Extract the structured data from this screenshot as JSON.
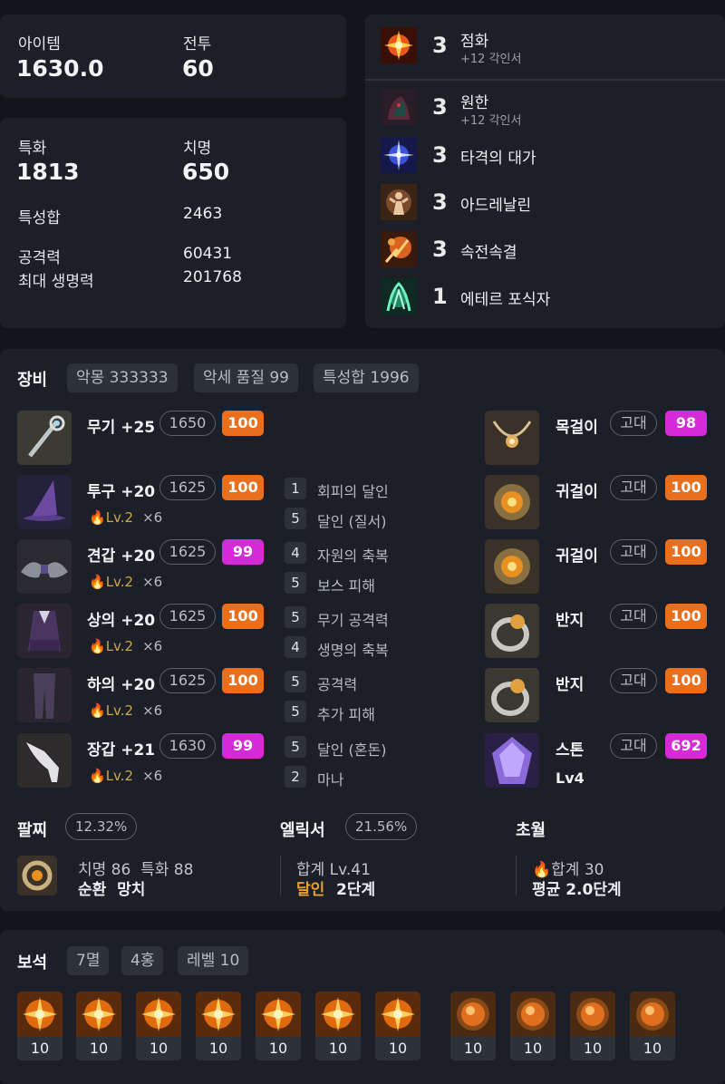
{
  "summary": {
    "item_label": "아이템",
    "item_value": "1630.0",
    "combat_label": "전투",
    "combat_value": "60"
  },
  "stats": {
    "spec_label": "특화",
    "spec_value": "1813",
    "crit_label": "치명",
    "crit_value": "650",
    "sum_label": "특성합",
    "sum_value": "2463",
    "atk_label": "공격력",
    "atk_value": "60431",
    "hp_label": "최대 생명력",
    "hp_value": "201768"
  },
  "engravings": [
    {
      "level": "3",
      "name": "점화",
      "sub": "+12 각인서",
      "icon": "fire-ignite-icon"
    },
    {
      "level": "3",
      "name": "원한",
      "sub": "+12 각인서",
      "icon": "grudge-icon"
    },
    {
      "level": "3",
      "name": "타격의 대가",
      "icon": "hit-master-icon"
    },
    {
      "level": "3",
      "name": "아드레날린",
      "icon": "adrenaline-icon"
    },
    {
      "level": "3",
      "name": "속전속결",
      "icon": "swift-strike-icon"
    },
    {
      "level": "1",
      "name": "에테르 포식자",
      "icon": "ether-predator-icon"
    }
  ],
  "equipment": {
    "title": "장비",
    "tags": [
      "악몽 333333",
      "악세 품질 99",
      "특성합 1996"
    ],
    "items": [
      {
        "name": "무기 +25",
        "ilvl": "1650",
        "quality": "100",
        "quality_color": "#ea6f1d",
        "icon": "weapon-staff-icon"
      },
      {
        "name": "투구 +20",
        "ilvl": "1625",
        "quality": "100",
        "quality_color": "#ea6f1d",
        "ability_stone": "Lv.2",
        "mult": "×6",
        "icon": "helmet-witch-hat-icon"
      },
      {
        "name": "견갑 +20",
        "ilvl": "1625",
        "quality": "99",
        "quality_color": "#d42bd6",
        "ability_stone": "Lv.2",
        "mult": "×6",
        "icon": "shoulder-armor-icon"
      },
      {
        "name": "상의 +20",
        "ilvl": "1625",
        "quality": "100",
        "quality_color": "#ea6f1d",
        "ability_stone": "Lv.2",
        "mult": "×6",
        "icon": "chest-armor-icon"
      },
      {
        "name": "하의 +20",
        "ilvl": "1625",
        "quality": "100",
        "quality_color": "#ea6f1d",
        "ability_stone": "Lv.2",
        "mult": "×6",
        "icon": "pants-armor-icon"
      },
      {
        "name": "장갑 +21",
        "ilvl": "1630",
        "quality": "99",
        "quality_color": "#d42bd6",
        "ability_stone": "Lv.2",
        "mult": "×6",
        "icon": "gloves-armor-icon"
      }
    ],
    "effects": [
      {
        "level": "1",
        "name": "회피의 달인"
      },
      {
        "level": "5",
        "name": "달인 (질서)"
      },
      {
        "level": "4",
        "name": "자원의 축복"
      },
      {
        "level": "5",
        "name": "보스 피해"
      },
      {
        "level": "5",
        "name": "무기 공격력"
      },
      {
        "level": "4",
        "name": "생명의 축복"
      },
      {
        "level": "5",
        "name": "공격력"
      },
      {
        "level": "5",
        "name": "추가 피해"
      },
      {
        "level": "5",
        "name": "달인 (혼돈)"
      },
      {
        "level": "2",
        "name": "마나"
      }
    ],
    "accessories": [
      {
        "name": "목걸이",
        "grade": "고대",
        "quality": "98",
        "quality_color": "#d42bd6",
        "icon": "necklace-icon"
      },
      {
        "name": "귀걸이",
        "grade": "고대",
        "quality": "100",
        "quality_color": "#ea6f1d",
        "icon": "earring-icon"
      },
      {
        "name": "귀걸이",
        "grade": "고대",
        "quality": "100",
        "quality_color": "#ea6f1d",
        "icon": "earring-icon"
      },
      {
        "name": "반지",
        "grade": "고대",
        "quality": "100",
        "quality_color": "#ea6f1d",
        "icon": "ring-icon"
      },
      {
        "name": "반지",
        "grade": "고대",
        "quality": "100",
        "quality_color": "#ea6f1d",
        "icon": "ring-icon"
      },
      {
        "name": "스톤",
        "grade": "고대",
        "quality": "692",
        "quality_color": "#d42bd6",
        "sub": "Lv4",
        "icon": "ability-stone-icon"
      }
    ]
  },
  "bracelet": {
    "title": "팔찌",
    "percent": "12.32%",
    "line1": "치명 86  특화 88",
    "line2": "순환  망치",
    "icon": "bracelet-icon"
  },
  "elixir": {
    "title": "엘릭서",
    "percent": "21.56%",
    "line1": "합계 Lv.41",
    "effect": "달인",
    "effect_level": "2단계"
  },
  "transcend": {
    "title": "초월",
    "line1": "합계 30",
    "line2": "평균 2.0단계"
  },
  "gems": {
    "title": "보석",
    "tags": [
      "7멸",
      "4홍",
      "레벨 10"
    ],
    "items": [
      {
        "level": "10",
        "type": "doom"
      },
      {
        "level": "10",
        "type": "doom"
      },
      {
        "level": "10",
        "type": "doom"
      },
      {
        "level": "10",
        "type": "doom"
      },
      {
        "level": "10",
        "type": "doom"
      },
      {
        "level": "10",
        "type": "doom"
      },
      {
        "level": "10",
        "type": "doom"
      },
      {
        "level": "10",
        "type": "crimson"
      },
      {
        "level": "10",
        "type": "crimson"
      },
      {
        "level": "10",
        "type": "crimson"
      },
      {
        "level": "10",
        "type": "crimson"
      }
    ]
  },
  "colors": {
    "accent_orange": "#ea6f1d",
    "accent_magenta": "#d42bd6",
    "elixir_effect": "#e8a234",
    "stone_gold": "#c9a84a"
  }
}
